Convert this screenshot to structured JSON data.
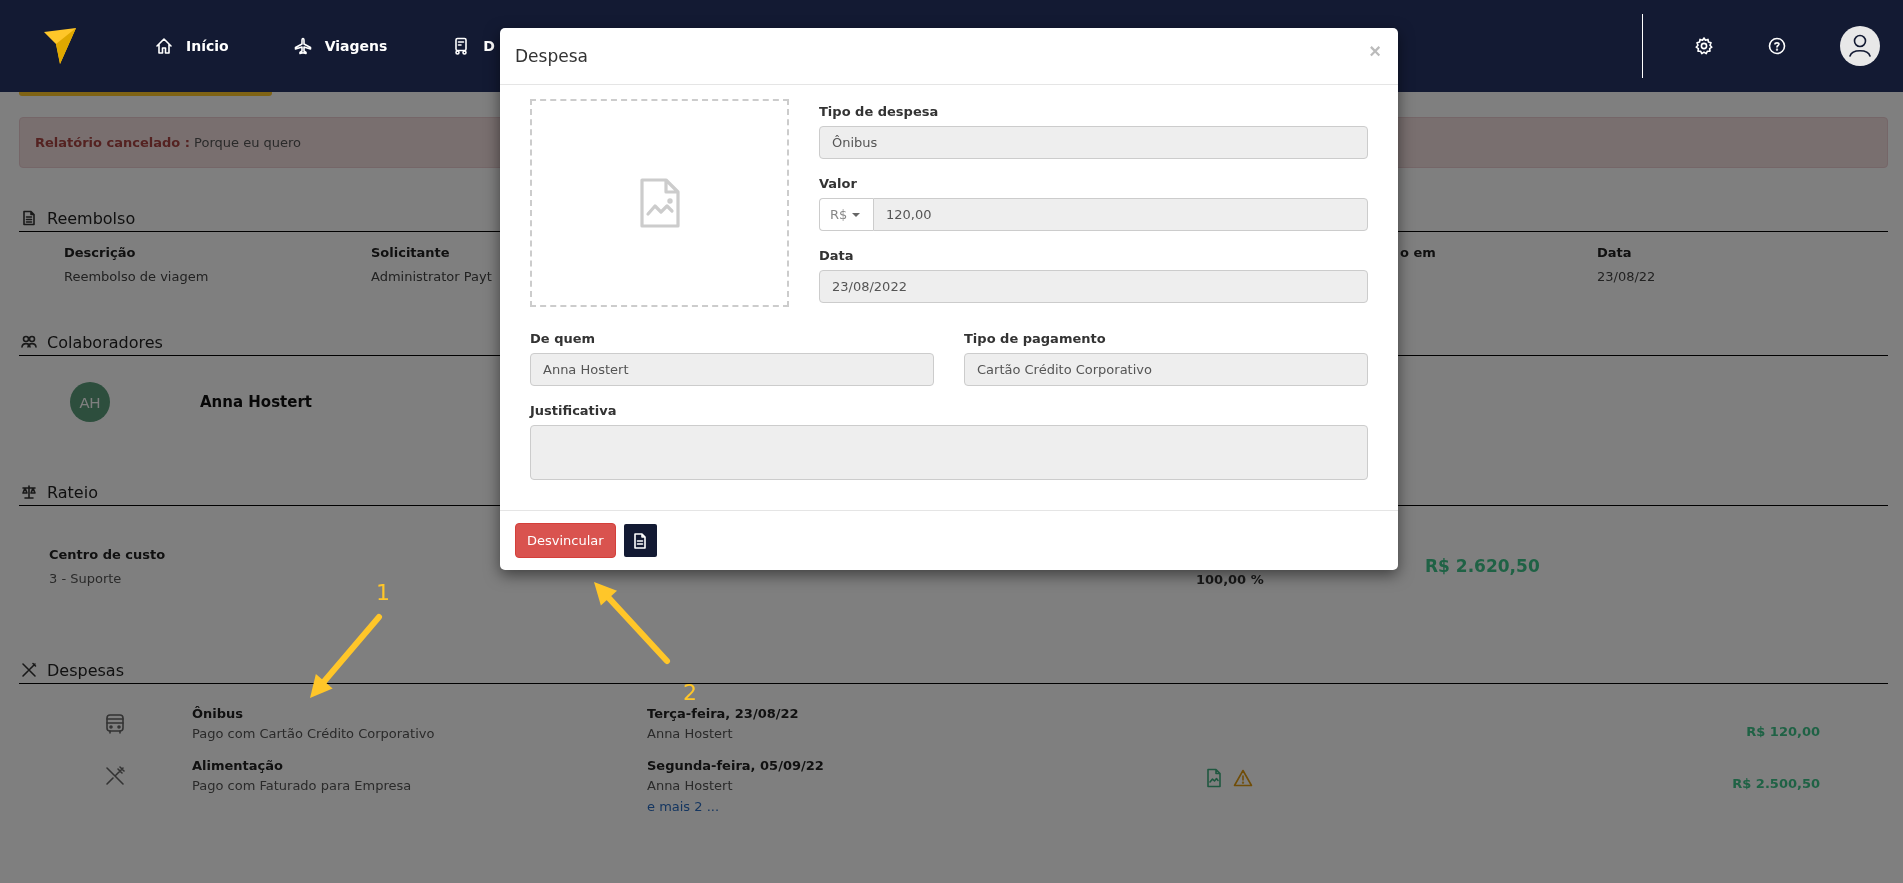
{
  "nav": {
    "items": [
      {
        "label": "Início"
      },
      {
        "label": "Viagens"
      },
      {
        "label": "D"
      }
    ]
  },
  "alert": {
    "title": "Relatório cancelado :",
    "text": "Porque eu quero"
  },
  "reimbursement": {
    "heading": "Reembolso",
    "columns": [
      {
        "header": "Descrição",
        "value": "Reembolso de viagem"
      },
      {
        "header": "Solicitante",
        "value": "Administrator Payt"
      },
      {
        "header": "o em"
      },
      {
        "header": "Data",
        "value": "23/08/22"
      }
    ]
  },
  "collaborators": {
    "heading": "Colaboradores",
    "people": [
      {
        "initials": "AH",
        "name": "Anna Hostert"
      }
    ]
  },
  "allocation": {
    "heading": "Rateio",
    "label": "Centro de custo",
    "value": "3 - Suporte",
    "percent": "100,00 %",
    "total": "R$ 2.620,50"
  },
  "expenses": {
    "heading": "Despesas",
    "items": [
      {
        "kind": "bus",
        "title": "Ônibus",
        "payment": "Pago com Cartão Crédito Corporativo",
        "date": "Terça-feira, 23/08/22",
        "person": "Anna Hostert",
        "attachment": false,
        "warning": false,
        "amount": "R$ 120,00"
      },
      {
        "kind": "food",
        "title": "Alimentação",
        "payment": "Pago com Faturado para Empresa",
        "date": "Segunda-feira, 05/09/22",
        "person": "Anna Hostert",
        "more": "e mais 2 ...",
        "attachment": true,
        "warning": true,
        "amount": "R$ 2.500,50"
      }
    ]
  },
  "modal": {
    "title": "Despesa",
    "close": "×",
    "expense_type": {
      "label": "Tipo de despesa",
      "value": "Ônibus"
    },
    "amount": {
      "label": "Valor",
      "currency": "R$",
      "value": "120,00"
    },
    "date": {
      "label": "Data",
      "value": "23/08/2022"
    },
    "from": {
      "label": "De quem",
      "value": "Anna Hostert"
    },
    "payment_type": {
      "label": "Tipo de pagamento",
      "value": "Cartão Crédito Corporativo"
    },
    "justification": {
      "label": "Justificativa"
    },
    "unlink_button": "Desvincular"
  },
  "annotations": [
    {
      "label": "1"
    },
    {
      "label": "2"
    }
  ]
}
